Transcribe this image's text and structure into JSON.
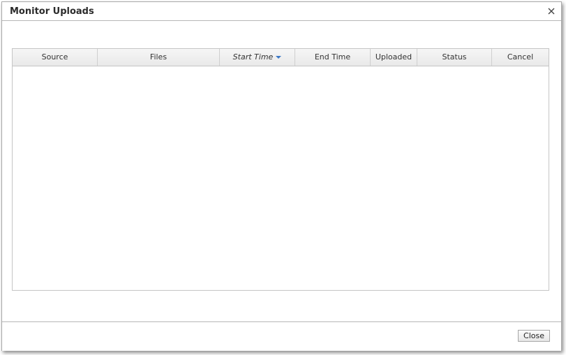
{
  "dialog": {
    "title": "Monitor Uploads",
    "close_icon": "close-icon"
  },
  "grid": {
    "columns": [
      {
        "label": "Source",
        "sorted": false
      },
      {
        "label": "Files",
        "sorted": false
      },
      {
        "label": "Start Time",
        "sorted": true,
        "sort_direction": "descending",
        "sort_icon": "sort-down-icon"
      },
      {
        "label": "End Time",
        "sorted": false
      },
      {
        "label": "Uploaded",
        "sorted": false
      },
      {
        "label": "Status",
        "sorted": false
      },
      {
        "label": "Cancel",
        "sorted": false
      }
    ],
    "rows": []
  },
  "footer": {
    "close_label": "Close"
  },
  "colors": {
    "sort_arrow": "#3b78c6",
    "border": "#c5c5c5",
    "header_bg": "#eeeeee"
  }
}
